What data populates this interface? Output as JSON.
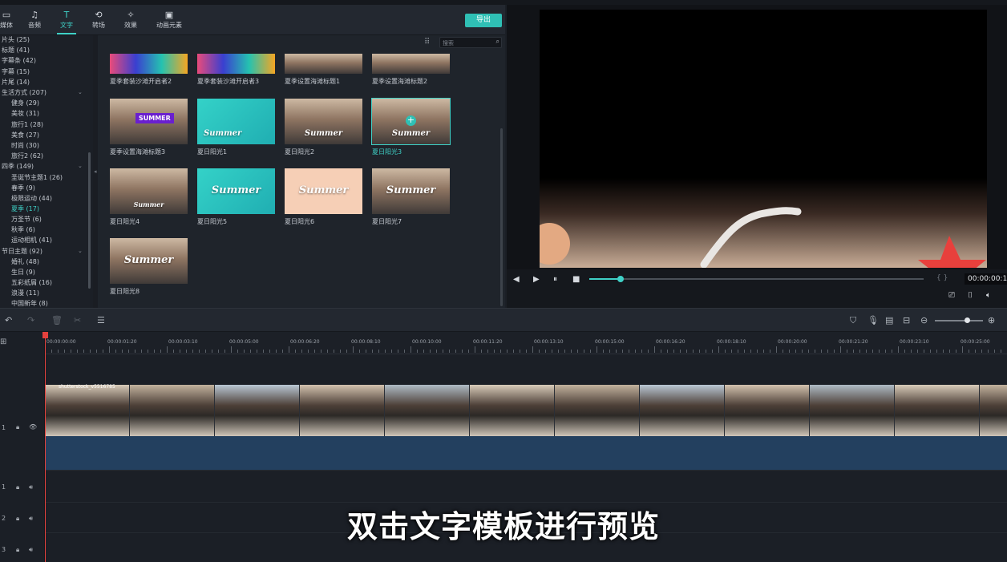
{
  "toolbar": {
    "tabs": [
      {
        "label": "媒体",
        "icon": "folder-icon"
      },
      {
        "label": "音频",
        "icon": "music-note-icon"
      },
      {
        "label": "文字",
        "icon": "text-icon"
      },
      {
        "label": "转场",
        "icon": "transition-icon"
      },
      {
        "label": "效果",
        "icon": "effects-icon"
      },
      {
        "label": "动画元素",
        "icon": "image-icon"
      }
    ],
    "active_tab": "文字",
    "export_label": "导出"
  },
  "sidebar": {
    "items": [
      {
        "label": "片头 (25)"
      },
      {
        "label": "标题 (41)"
      },
      {
        "label": "字幕条 (42)"
      },
      {
        "label": "字幕 (15)"
      },
      {
        "label": "片尾 (14)"
      },
      {
        "label": "生活方式 (207)"
      },
      {
        "label": "健身 (29)"
      },
      {
        "label": "美妆 (31)"
      },
      {
        "label": "旅行1 (28)"
      },
      {
        "label": "美食 (27)"
      },
      {
        "label": "时尚 (30)"
      },
      {
        "label": "旅行2 (62)"
      },
      {
        "label": "四季 (149)"
      },
      {
        "label": "圣诞节主题1 (26)"
      },
      {
        "label": "春季 (9)"
      },
      {
        "label": "极限运动 (44)"
      },
      {
        "label": "夏季 (17)"
      },
      {
        "label": "万圣节 (6)"
      },
      {
        "label": "秋季 (6)"
      },
      {
        "label": "运动相机 (41)"
      },
      {
        "label": "节日主题 (92)"
      },
      {
        "label": "婚礼 (48)"
      },
      {
        "label": "生日 (9)"
      },
      {
        "label": "五彩纸屑 (16)"
      },
      {
        "label": "浪漫 (11)"
      },
      {
        "label": "中国新年 (8)"
      }
    ],
    "selected": "夏季 (17)"
  },
  "search": {
    "placeholder": "搜索"
  },
  "templates": [
    {
      "label": "夏季套装沙滩开启者2",
      "text": ""
    },
    {
      "label": "夏季套装沙滩开启者3",
      "text": ""
    },
    {
      "label": "夏季设置海滩标题1",
      "text": ""
    },
    {
      "label": "夏季设置海滩标题2",
      "text": ""
    },
    {
      "label": "夏季设置海滩标题3",
      "text": "SUMMER"
    },
    {
      "label": "夏日阳光1",
      "text": "Summer"
    },
    {
      "label": "夏日阳光2",
      "text": "Summer"
    },
    {
      "label": "夏日阳光3",
      "text": "Summer"
    },
    {
      "label": "夏日阳光4",
      "text": "Summer"
    },
    {
      "label": "夏日阳光5",
      "text": "Summer"
    },
    {
      "label": "夏日阳光6",
      "text": "Summer"
    },
    {
      "label": "夏日阳光7",
      "text": "Summer"
    },
    {
      "label": "夏日阳光8",
      "text": "Summer"
    }
  ],
  "selected_template": "夏日阳光3",
  "preview": {
    "timecode": "00:00:00:1"
  },
  "ruler": [
    "00:00:00:00",
    "00:00:01:20",
    "00:00:03:10",
    "00:00:05:00",
    "00:00:06:20",
    "00:00:08:10",
    "00:00:10:00",
    "00:00:11:20",
    "00:00:13:10",
    "00:00:15:00",
    "00:00:16:20",
    "00:00:18:10",
    "00:00:20:00",
    "00:00:21:20",
    "00:00:23:10",
    "00:00:25:00"
  ],
  "clip": {
    "name": "shutterstock_v5516785"
  },
  "tracks": {
    "video_label": "1",
    "audio1_label": "1",
    "audio2_label": "2",
    "audio3_label": "3"
  },
  "subtitle": "双击文字模板进行预览"
}
